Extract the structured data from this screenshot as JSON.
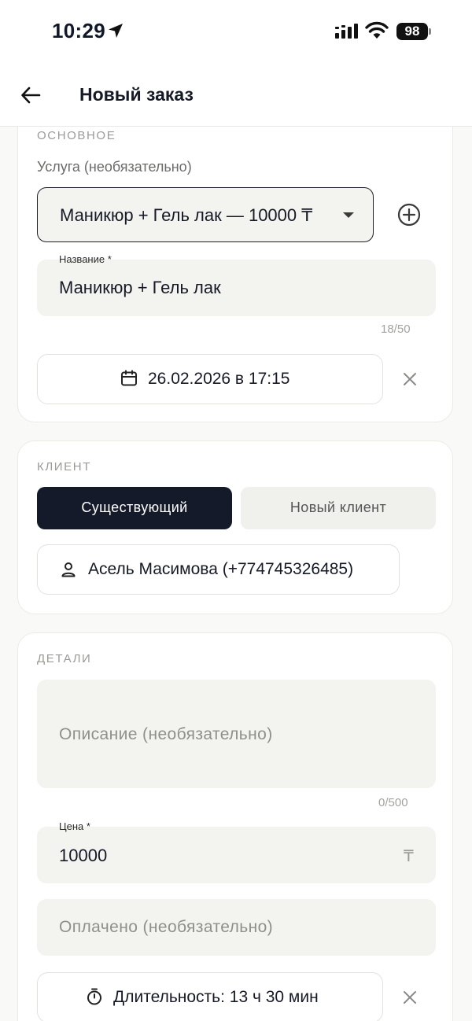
{
  "status_bar": {
    "time": "10:29",
    "battery": "98"
  },
  "header": {
    "title": "Новый заказ"
  },
  "basics": {
    "section_label": "ОСНОВНОЕ",
    "service_label": "Услуга (необязательно)",
    "service_value": "Маникюр + Гель лак — 10000 ₸",
    "name_label": "Название *",
    "name_value": "Маникюр + Гель лак",
    "name_counter": "18/50",
    "datetime": "26.02.2026 в 17:15"
  },
  "client": {
    "section_label": "КЛИЕНТ",
    "tab_existing": "Существующий",
    "tab_new": "Новый клиент",
    "selected_client": "Асель Масимова (+774745326485)"
  },
  "details": {
    "section_label": "ДЕТАЛИ",
    "description_placeholder": "Описание (необязательно)",
    "description_counter": "0/500",
    "price_label": "Цена *",
    "price_value": "10000",
    "currency_symbol": "₸",
    "paid_placeholder": "Оплачено (необязательно)",
    "duration": "Длительность: 13 ч 30 мин"
  },
  "colors": {
    "primary": "#151a2a",
    "input_fill": "#f3f3ef",
    "background": "#f9f9f7"
  }
}
